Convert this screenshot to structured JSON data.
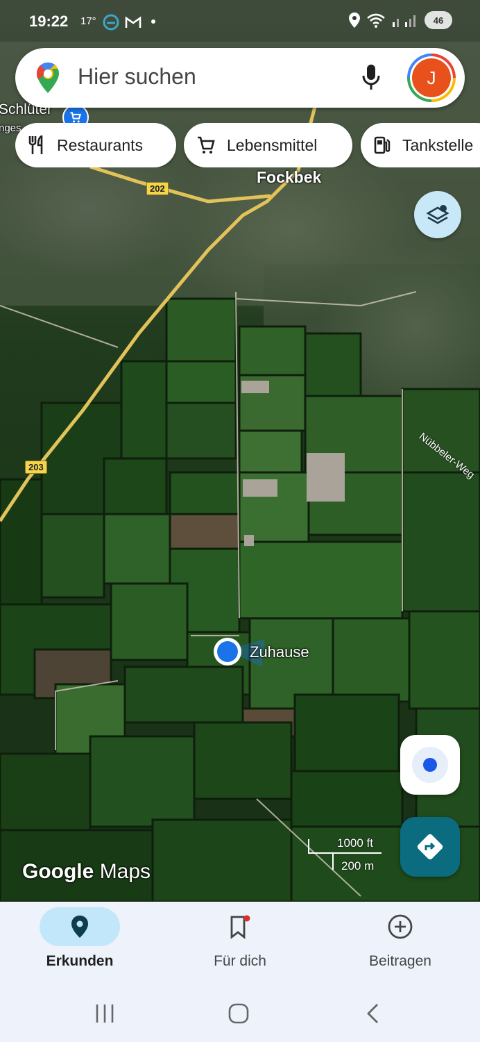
{
  "status_bar": {
    "time": "19:22",
    "temperature": "17°",
    "battery": "46"
  },
  "search": {
    "placeholder": "Hier suchen",
    "avatar_initial": "J"
  },
  "chips": [
    {
      "label": "Restaurants",
      "icon": "fork-knife-icon"
    },
    {
      "label": "Lebensmittel",
      "icon": "shopping-cart-icon"
    },
    {
      "label": "Tankstelle",
      "icon": "gas-station-icon"
    }
  ],
  "map": {
    "town_label": "Fockbek",
    "poi_label": "Schlüter",
    "poi_label_sub": "nges",
    "route_202": "202",
    "route_203": "203",
    "street_label": "Nübbeler-Weg",
    "home_label": "Zuhause",
    "scale_ft": "1000 ft",
    "scale_m": "200 m",
    "watermark_google": "Google",
    "watermark_maps": "Maps"
  },
  "bottom_nav": [
    {
      "label": "Erkunden",
      "icon": "location-pin-icon",
      "active": true
    },
    {
      "label": "Für dich",
      "icon": "bookmark-icon",
      "active": false
    },
    {
      "label": "Beitragen",
      "icon": "add-circle-icon",
      "active": false
    }
  ],
  "colors": {
    "accent": "#0b6c80",
    "location_blue": "#1a73e8",
    "active_nav_bg": "#c3e7fa",
    "nav_bg": "#eef3fb"
  }
}
